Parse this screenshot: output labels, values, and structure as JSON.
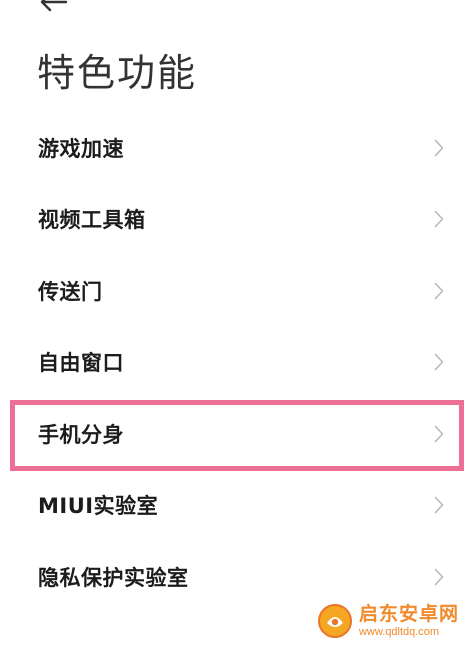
{
  "header": {
    "back_icon": "arrow-left-icon",
    "title": "特色功能"
  },
  "menu": {
    "items": [
      {
        "label": "游戏加速",
        "icon": "chevron-right-icon",
        "highlighted": false
      },
      {
        "label": "视频工具箱",
        "icon": "chevron-right-icon",
        "highlighted": false
      },
      {
        "label": "传送门",
        "icon": "chevron-right-icon",
        "highlighted": false
      },
      {
        "label": "自由窗口",
        "icon": "chevron-right-icon",
        "highlighted": false
      },
      {
        "label": "手机分身",
        "icon": "chevron-right-icon",
        "highlighted": true
      },
      {
        "label": "MIUI实验室",
        "icon": "chevron-right-icon",
        "highlighted": false
      },
      {
        "label": "隐私保护实验室",
        "icon": "chevron-right-icon",
        "highlighted": false
      }
    ]
  },
  "watermark": {
    "name": "启东安卓网",
    "url": "www.qdltdq.com"
  },
  "colors": {
    "highlight_border": "#ec6f96",
    "title_text": "#333333",
    "item_text": "#1c1c1c",
    "chevron": "#b8b8b8",
    "watermark": "#f08a2c"
  }
}
